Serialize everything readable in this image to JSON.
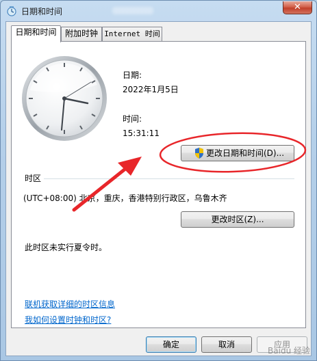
{
  "window": {
    "title": "日期和时间",
    "close_glyph": "✕"
  },
  "tabs": [
    {
      "label": "日期和时间",
      "active": true
    },
    {
      "label": "附加时钟",
      "active": false
    },
    {
      "label": "Internet 时间",
      "active": false
    }
  ],
  "datetime": {
    "date_label": "日期:",
    "date_value": "2022年1月5日",
    "time_label": "时间:",
    "time_value": "15:31:11",
    "change_button": "更改日期和时间(D)..."
  },
  "timezone": {
    "section_label": "时区",
    "value": "(UTC+08:00) 北京，重庆，香港特别行政区，乌鲁木齐",
    "change_button": "更改时区(Z)...",
    "dst_note": "此时区未实行夏令时。"
  },
  "links": {
    "online_info": "联机获取详细的时区信息",
    "how_to": "我如何设置时钟和时区?"
  },
  "footer": {
    "ok": "确定",
    "cancel": "取消",
    "apply": "应用"
  },
  "watermark": "Baidu 经验",
  "colors": {
    "link": "#0066cc",
    "annotation_red": "#e8262a"
  },
  "icons": {
    "window": "clock-globe-icon",
    "shield": "uac-shield-icon"
  }
}
